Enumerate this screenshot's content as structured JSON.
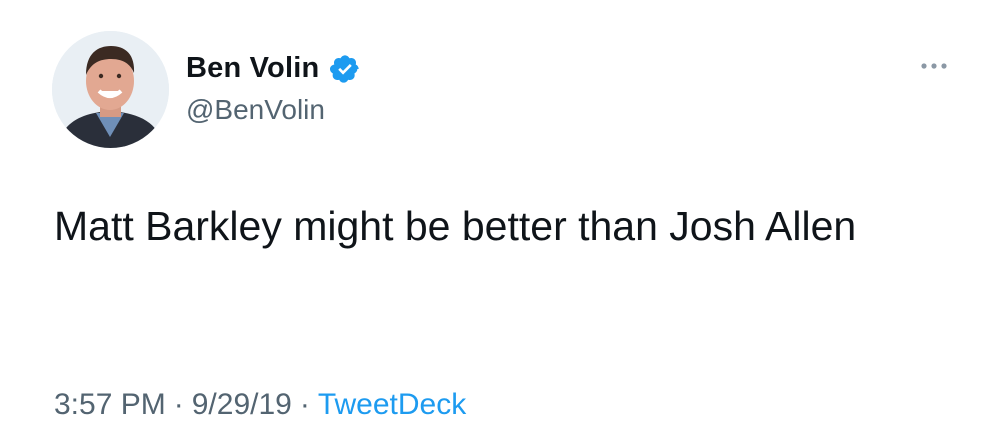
{
  "author": {
    "display_name": "Ben Volin",
    "handle": "@BenVolin",
    "verified": true,
    "avatar_icon": "profile-photo"
  },
  "tweet": {
    "text": "Matt Barkley might be better than Josh Allen",
    "time": "3:57 PM",
    "date": "9/29/19",
    "separator": "·",
    "source": "TweetDeck"
  },
  "icons": {
    "verified": "verified-badge-icon",
    "more": "more-options-icon"
  },
  "colors": {
    "text": "#0f1419",
    "secondary_text": "#536471",
    "link": "#1d9bf0",
    "verified": "#1d9bf0"
  }
}
